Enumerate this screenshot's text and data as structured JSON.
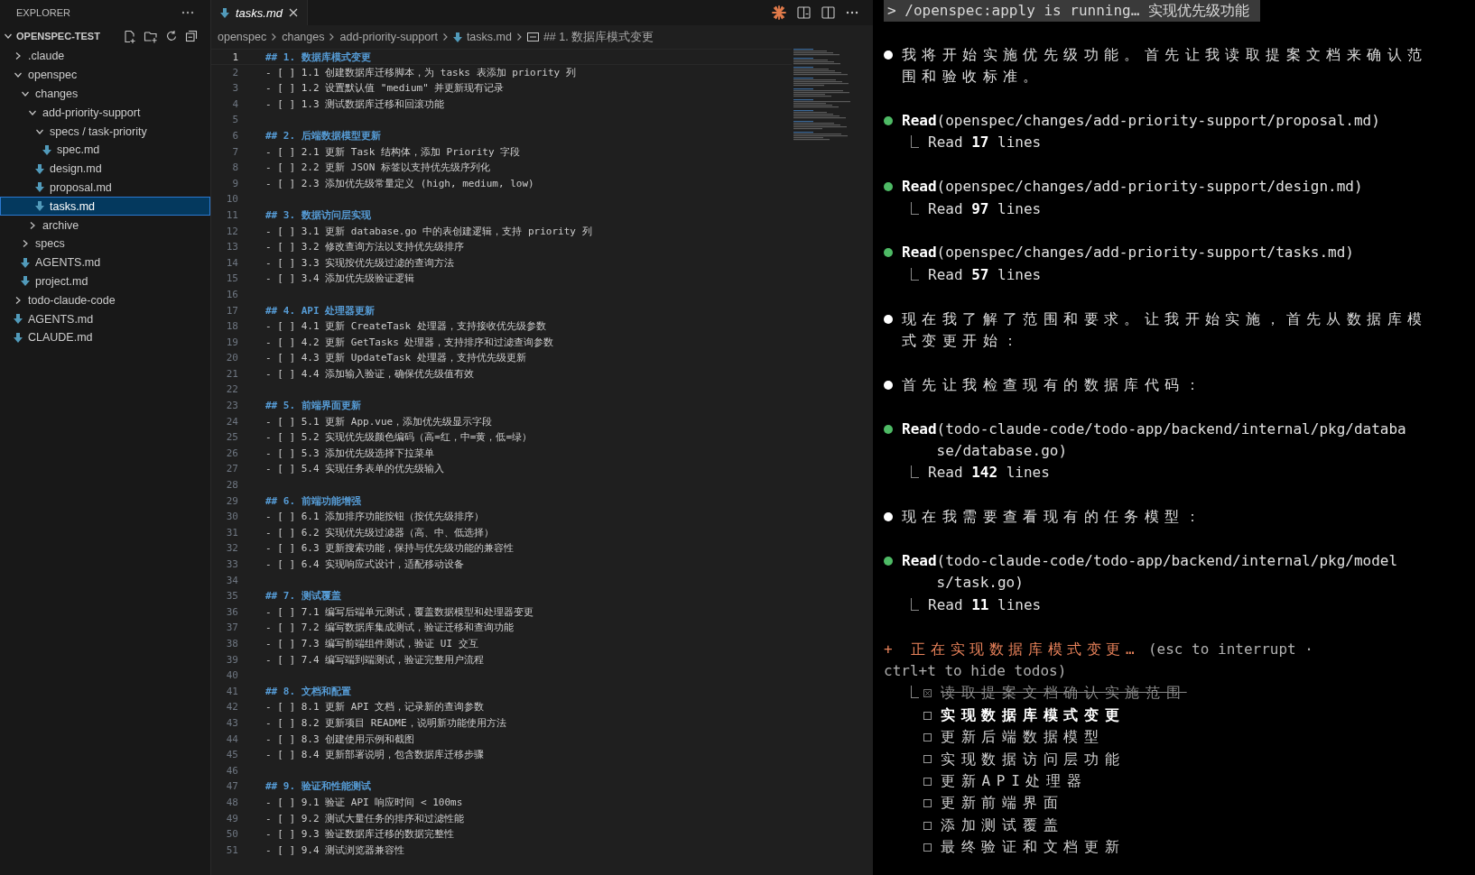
{
  "sidebar": {
    "title": "EXPLORER",
    "root": {
      "label": "OPENSPEC-TEST",
      "expanded": true,
      "children": [
        {
          "label": ".claude",
          "kind": "folder",
          "expanded": false,
          "selected": false
        },
        {
          "label": "openspec",
          "kind": "folder",
          "expanded": true,
          "selected": false,
          "children": [
            {
              "label": "changes",
              "kind": "folder",
              "expanded": true,
              "selected": false,
              "children": [
                {
                  "label": "add-priority-support",
                  "kind": "folder",
                  "expanded": true,
                  "selected": false,
                  "children": [
                    {
                      "label": "specs / task-priority",
                      "kind": "folder",
                      "expanded": true,
                      "selected": false,
                      "children": [
                        {
                          "label": "spec.md",
                          "kind": "file",
                          "selected": false
                        }
                      ]
                    },
                    {
                      "label": "design.md",
                      "kind": "file",
                      "selected": false
                    },
                    {
                      "label": "proposal.md",
                      "kind": "file",
                      "selected": false
                    },
                    {
                      "label": "tasks.md",
                      "kind": "file",
                      "selected": true
                    }
                  ]
                },
                {
                  "label": "archive",
                  "kind": "folder",
                  "expanded": false,
                  "selected": false
                }
              ]
            },
            {
              "label": "specs",
              "kind": "folder",
              "expanded": false,
              "selected": false
            },
            {
              "label": "AGENTS.md",
              "kind": "file",
              "selected": false
            },
            {
              "label": "project.md",
              "kind": "file",
              "selected": false
            }
          ]
        },
        {
          "label": "todo-claude-code",
          "kind": "folder",
          "expanded": false,
          "selected": false
        },
        {
          "label": "AGENTS.md",
          "kind": "file",
          "selected": false
        },
        {
          "label": "CLAUDE.md",
          "kind": "file",
          "selected": false
        }
      ]
    }
  },
  "editor": {
    "tab": {
      "label": "tasks.md",
      "selected": true
    },
    "breadcrumb": [
      {
        "kind": "folder",
        "label": "openspec"
      },
      {
        "kind": "folder",
        "label": "changes"
      },
      {
        "kind": "folder",
        "label": "add-priority-support"
      },
      {
        "kind": "file",
        "label": "tasks.md"
      },
      {
        "kind": "symbol",
        "label": "## 1. 数据库模式变更"
      }
    ],
    "lines": [
      {
        "number": "1",
        "kind": "heading",
        "text": "## 1. 数据库模式变更"
      },
      {
        "number": "2",
        "kind": "task",
        "text": "- [ ] 1.1 创建数据库迁移脚本，为 tasks 表添加 priority 列"
      },
      {
        "number": "3",
        "kind": "task",
        "text": "- [ ] 1.2 设置默认值 \"medium\" 并更新现有记录"
      },
      {
        "number": "4",
        "kind": "task",
        "text": "- [ ] 1.3 测试数据库迁移和回滚功能"
      },
      {
        "number": "5",
        "kind": "blank"
      },
      {
        "number": "6",
        "kind": "heading",
        "text": "## 2. 后端数据模型更新"
      },
      {
        "number": "7",
        "kind": "task",
        "text": "- [ ] 2.1 更新 Task 结构体，添加 Priority 字段"
      },
      {
        "number": "8",
        "kind": "task",
        "text": "- [ ] 2.2 更新 JSON 标签以支持优先级序列化"
      },
      {
        "number": "9",
        "kind": "task",
        "text": "- [ ] 2.3 添加优先级常量定义 (high, medium, low)"
      },
      {
        "number": "10",
        "kind": "blank"
      },
      {
        "number": "11",
        "kind": "heading",
        "text": "## 3. 数据访问层实现"
      },
      {
        "number": "12",
        "kind": "task",
        "text": "- [ ] 3.1 更新 database.go 中的表创建逻辑，支持 priority 列"
      },
      {
        "number": "13",
        "kind": "task",
        "text": "- [ ] 3.2 修改查询方法以支持优先级排序"
      },
      {
        "number": "14",
        "kind": "task",
        "text": "- [ ] 3.3 实现按优先级过滤的查询方法"
      },
      {
        "number": "15",
        "kind": "task",
        "text": "- [ ] 3.4 添加优先级验证逻辑"
      },
      {
        "number": "16",
        "kind": "blank"
      },
      {
        "number": "17",
        "kind": "heading",
        "text": "## 4. API 处理器更新"
      },
      {
        "number": "18",
        "kind": "task",
        "text": "- [ ] 4.1 更新 CreateTask 处理器，支持接收优先级参数"
      },
      {
        "number": "19",
        "kind": "task",
        "text": "- [ ] 4.2 更新 GetTasks 处理器，支持排序和过滤查询参数"
      },
      {
        "number": "20",
        "kind": "task",
        "text": "- [ ] 4.3 更新 UpdateTask 处理器，支持优先级更新"
      },
      {
        "number": "21",
        "kind": "task",
        "text": "- [ ] 4.4 添加输入验证，确保优先级值有效"
      },
      {
        "number": "22",
        "kind": "blank"
      },
      {
        "number": "23",
        "kind": "heading",
        "text": "## 5. 前端界面更新"
      },
      {
        "number": "24",
        "kind": "task",
        "text": "- [ ] 5.1 更新 App.vue，添加优先级显示字段"
      },
      {
        "number": "25",
        "kind": "task",
        "text": "- [ ] 5.2 实现优先级颜色编码（高=红，中=黄，低=绿）"
      },
      {
        "number": "26",
        "kind": "task",
        "text": "- [ ] 5.3 添加优先级选择下拉菜单"
      },
      {
        "number": "27",
        "kind": "task",
        "text": "- [ ] 5.4 实现任务表单的优先级输入"
      },
      {
        "number": "28",
        "kind": "blank"
      },
      {
        "number": "29",
        "kind": "heading",
        "text": "## 6. 前端功能增强"
      },
      {
        "number": "30",
        "kind": "task",
        "text": "- [ ] 6.1 添加排序功能按钮（按优先级排序）"
      },
      {
        "number": "31",
        "kind": "task",
        "text": "- [ ] 6.2 实现优先级过滤器（高、中、低选择）"
      },
      {
        "number": "32",
        "kind": "task",
        "text": "- [ ] 6.3 更新搜索功能，保持与优先级功能的兼容性"
      },
      {
        "number": "33",
        "kind": "task",
        "text": "- [ ] 6.4 实现响应式设计，适配移动设备"
      },
      {
        "number": "34",
        "kind": "blank"
      },
      {
        "number": "35",
        "kind": "heading",
        "text": "## 7. 测试覆盖"
      },
      {
        "number": "36",
        "kind": "task",
        "text": "- [ ] 7.1 编写后端单元测试，覆盖数据模型和处理器变更"
      },
      {
        "number": "37",
        "kind": "task",
        "text": "- [ ] 7.2 编写数据库集成测试，验证迁移和查询功能"
      },
      {
        "number": "38",
        "kind": "task",
        "text": "- [ ] 7.3 编写前端组件测试，验证 UI 交互"
      },
      {
        "number": "39",
        "kind": "task",
        "text": "- [ ] 7.4 编写端到端测试，验证完整用户流程"
      },
      {
        "number": "40",
        "kind": "blank"
      },
      {
        "number": "41",
        "kind": "heading",
        "text": "## 8. 文档和配置"
      },
      {
        "number": "42",
        "kind": "task",
        "text": "- [ ] 8.1 更新 API 文档，记录新的查询参数"
      },
      {
        "number": "43",
        "kind": "task",
        "text": "- [ ] 8.2 更新项目 README，说明新功能使用方法"
      },
      {
        "number": "44",
        "kind": "task",
        "text": "- [ ] 8.3 创建使用示例和截图"
      },
      {
        "number": "45",
        "kind": "task",
        "text": "- [ ] 8.4 更新部署说明，包含数据库迁移步骤"
      },
      {
        "number": "46",
        "kind": "blank"
      },
      {
        "number": "47",
        "kind": "heading",
        "text": "## 9. 验证和性能测试"
      },
      {
        "number": "48",
        "kind": "task",
        "text": "- [ ] 9.1 验证 API 响应时间 < 100ms"
      },
      {
        "number": "49",
        "kind": "task",
        "text": "- [ ] 9.2 测试大量任务的排序和过滤性能"
      },
      {
        "number": "50",
        "kind": "task",
        "text": "- [ ] 9.3 验证数据库迁移的数据完整性"
      },
      {
        "number": "51",
        "kind": "task",
        "text": "- [ ] 9.4 测试浏览器兼容性"
      }
    ]
  },
  "terminal": {
    "command": "> /openspec:apply is running… 实现优先级功能",
    "messages": [
      {
        "kind": "text",
        "text": "我将开始实施优先级功能。首先让我读取提案文档来确认范围和验收标准。"
      },
      {
        "kind": "tool",
        "name": "Read",
        "target": "(openspec/changes/add-priority-support/proposal.md)",
        "result": "Read **17** lines"
      },
      {
        "kind": "tool",
        "name": "Read",
        "target": "(openspec/changes/add-priority-support/design.md)",
        "result": "Read **97** lines"
      },
      {
        "kind": "tool",
        "name": "Read",
        "target": "(openspec/changes/add-priority-support/tasks.md)",
        "result": "Read **57** lines"
      },
      {
        "kind": "text",
        "text": "现在我了解了范围和要求。让我开始实施，首先从数据库模式变更开始："
      },
      {
        "kind": "text",
        "text": "首先让我检查现有的数据库代码："
      },
      {
        "kind": "tool",
        "name": "Read",
        "target": "(todo-claude-code/todo-app/backend/internal/pkg/database/database.go)",
        "result": "Read **142** lines"
      },
      {
        "kind": "text",
        "text": "现在我需要查看现有的任务模型："
      },
      {
        "kind": "tool",
        "name": "Read",
        "target": "(todo-claude-code/todo-app/backend/internal/pkg/models/task.go)",
        "result": "Read **11** lines"
      }
    ],
    "status": {
      "text": "+ 正在实现数据库模式变更…",
      "hint": "(esc to interrupt · ctrl+t to hide todos)"
    },
    "todos": [
      {
        "text": "读取提案文档确认实施范围",
        "done": true,
        "active": false
      },
      {
        "text": "实现数据库模式变更",
        "done": false,
        "active": true
      },
      {
        "text": "更新后端数据模型",
        "done": false,
        "active": false
      },
      {
        "text": "实现数据访问层功能",
        "done": false,
        "active": false
      },
      {
        "text": "更新API处理器",
        "done": false,
        "active": false
      },
      {
        "text": "更新前端界面",
        "done": false,
        "active": false
      },
      {
        "text": "添加测试覆盖",
        "done": false,
        "active": false
      },
      {
        "text": "最终验证和文档更新",
        "done": false,
        "active": false
      }
    ]
  }
}
